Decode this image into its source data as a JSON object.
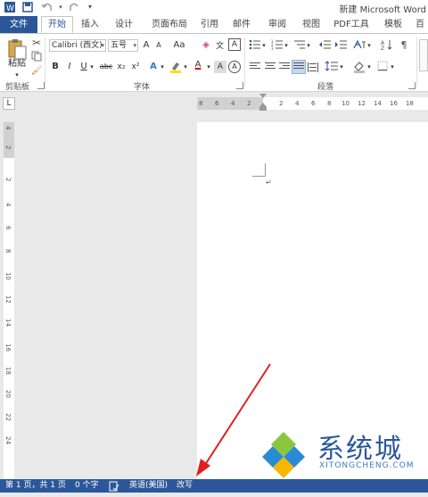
{
  "title_bar": {
    "title": "新建 Microsoft Word",
    "quick_access": [
      "save-icon",
      "undo-icon",
      "redo-icon",
      "customize-icon"
    ]
  },
  "tabs": [
    "文件",
    "开始",
    "插入",
    "设计",
    "页面布局",
    "引用",
    "邮件",
    "审阅",
    "视图",
    "PDF工具",
    "模板",
    "百"
  ],
  "active_tab": "开始",
  "clipboard": {
    "paste_label": "粘贴",
    "group_label": "剪贴板"
  },
  "font": {
    "name": "Calibri (西文)",
    "size": "五号",
    "group_label": "字体",
    "buttons": [
      "A",
      "A",
      "Aa",
      "B",
      "I",
      "U",
      "abc",
      "x₂",
      "x²",
      "A",
      "A",
      "A",
      "A"
    ]
  },
  "paragraph": {
    "group_label": "段落"
  },
  "ruler": {
    "ticks": [
      "8",
      "6",
      "4",
      "2",
      "2",
      "4",
      "6",
      "8",
      "10",
      "12",
      "14",
      "16",
      "18"
    ],
    "vticks": [
      "4",
      "2",
      "2",
      "4",
      "6",
      "8",
      "10",
      "12",
      "14",
      "16",
      "18",
      "20",
      "22",
      "24"
    ]
  },
  "status": {
    "page": "第 1 页，共 1 页",
    "words": "0 个字",
    "language": "英语(美国)",
    "mode": "改写"
  },
  "watermark": {
    "text": "系统城",
    "sub": "XITONGCHENG.COM"
  },
  "colors": {
    "accent": "#2b579a",
    "arrow": "#e02020"
  }
}
